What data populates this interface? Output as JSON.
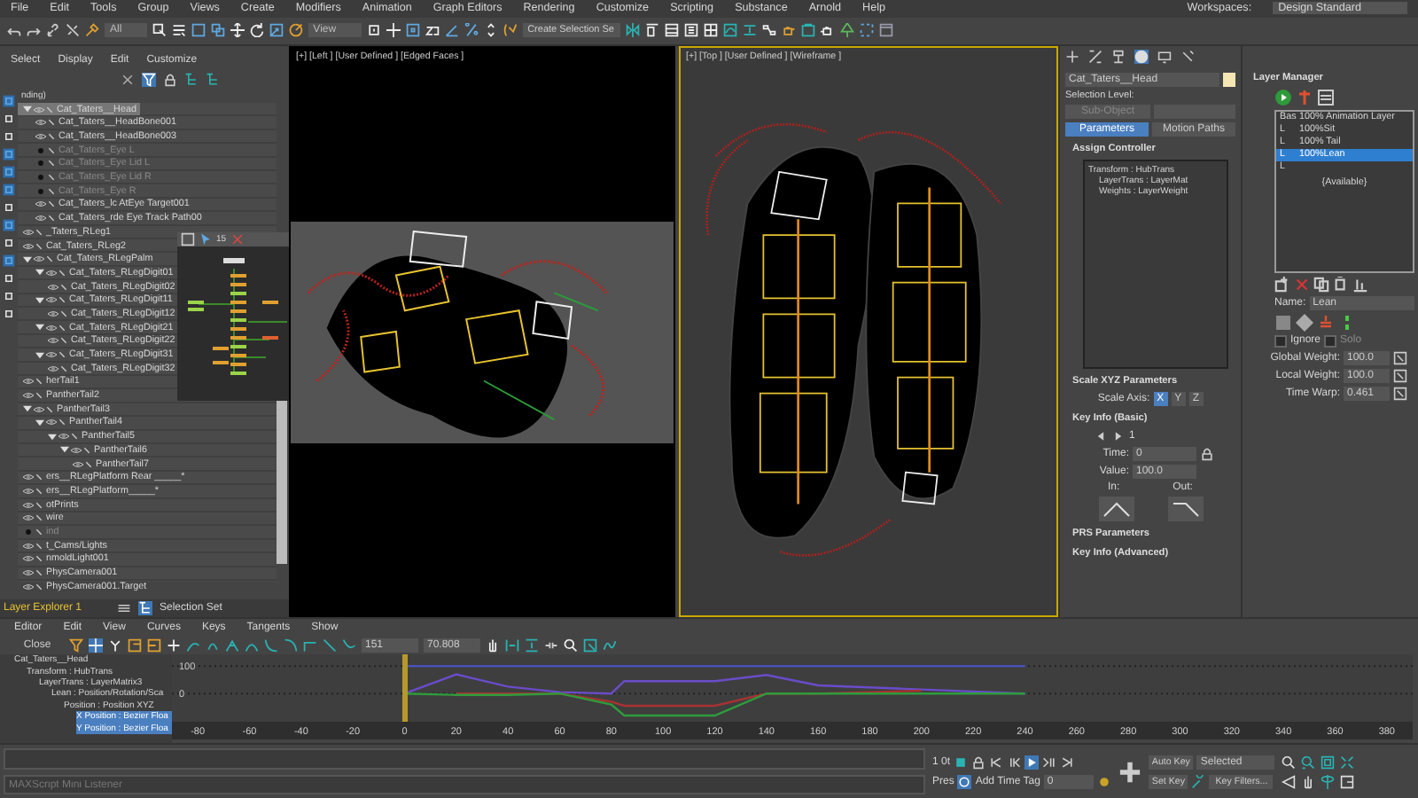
{
  "menu_bar": {
    "items": [
      "File",
      "Edit",
      "Tools",
      "Group",
      "Views",
      "Create",
      "Modifiers",
      "Animation",
      "Graph Editors",
      "Rendering",
      "Customize",
      "Scripting",
      "Substance",
      "Arnold",
      "Help"
    ],
    "workspaces_label": "Workspaces:",
    "workspace": "Design Standard"
  },
  "main_toolbar": {
    "selection_filter": "All",
    "reference_coord": "View",
    "selection_set_button": "Create Selection Se"
  },
  "scene_explorer": {
    "tabs": [
      "Select",
      "Display",
      "Edit",
      "Customize"
    ],
    "header": "nding)",
    "tree": [
      {
        "label": "Cat_Taters__Head",
        "selected": true,
        "visible": true,
        "children": [
          {
            "label": "Cat_Taters__HeadBone001",
            "selected": false,
            "visible": true
          },
          {
            "label": "Cat_Taters__HeadBone003",
            "selected": false,
            "visible": true
          },
          {
            "label": "Cat_Taters_Eye L",
            "selected": false,
            "visible": false
          },
          {
            "label": "Cat_Taters_Eye Lid L",
            "selected": false,
            "visible": false
          },
          {
            "label": "Cat_Taters_Eye Lid R",
            "selected": false,
            "visible": false
          },
          {
            "label": "Cat_Taters_Eye R",
            "selected": false,
            "visible": false
          },
          {
            "label": "Cat_Taters_lc AtEye Target001",
            "selected": false,
            "visible": true
          },
          {
            "label": "Cat_Taters_rde Eye Track Path00",
            "selected": false,
            "visible": true
          }
        ]
      },
      {
        "label": "_Taters_RLeg1",
        "selected": false,
        "visible": true
      },
      {
        "label": "Cat_Taters_RLeg2",
        "selected": false,
        "visible": true
      },
      {
        "label": "Cat_Taters_RLegPalm",
        "selected": false,
        "visible": true,
        "children": [
          {
            "label": "Cat_Taters_RLegDigit01",
            "selected": false,
            "visible": true,
            "children": [
              {
                "label": "Cat_Taters_RLegDigit02",
                "selected": false,
                "visible": true
              }
            ]
          },
          {
            "label": "Cat_Taters_RLegDigit11",
            "selected": false,
            "visible": true,
            "children": [
              {
                "label": "Cat_Taters_RLegDigit12",
                "selected": false,
                "visible": true
              }
            ]
          },
          {
            "label": "Cat_Taters_RLegDigit21",
            "selected": false,
            "visible": true,
            "children": [
              {
                "label": "Cat_Taters_RLegDigit22",
                "selected": false,
                "visible": true
              }
            ]
          },
          {
            "label": "Cat_Taters_RLegDigit31",
            "selected": false,
            "visible": true,
            "children": [
              {
                "label": "Cat_Taters_RLegDigit32",
                "selected": false,
                "visible": true
              }
            ]
          }
        ]
      },
      {
        "label": "herTail1",
        "selected": false,
        "visible": true
      },
      {
        "label": "PantherTail2",
        "selected": false,
        "visible": true
      },
      {
        "label": "PantherTail3",
        "selected": false,
        "visible": true,
        "children": [
          {
            "label": "PantherTail4",
            "selected": false,
            "visible": true,
            "children": [
              {
                "label": "PantherTail5",
                "selected": false,
                "visible": true,
                "children": [
                  {
                    "label": "PantherTail6",
                    "selected": false,
                    "visible": true,
                    "children": [
                      {
                        "label": "PantherTail7",
                        "selected": false,
                        "visible": true
                      }
                    ]
                  }
                ]
              }
            ]
          }
        ]
      },
      {
        "label": "ers__RLegPlatform Rear _____*",
        "selected": false,
        "visible": true
      },
      {
        "label": "ers__RLegPlatform_____*",
        "selected": false,
        "visible": true
      },
      {
        "label": "otPrints",
        "selected": false,
        "visible": true
      },
      {
        "label": "wire",
        "selected": false,
        "visible": true
      },
      {
        "label": "ind",
        "selected": false,
        "visible": false
      },
      {
        "label": "t_Cams/Lights",
        "selected": false,
        "visible": true
      },
      {
        "label": "nmoldLight001",
        "selected": false,
        "visible": true
      },
      {
        "label": "PhysCamera001",
        "selected": false,
        "visible": true
      },
      {
        "label": "PhysCamera001.Target",
        "selected": false,
        "visible": true
      }
    ],
    "explorer_name": "Layer Explorer 1",
    "selection_set": "Selection Set"
  },
  "schematic_view": {
    "count": "15"
  },
  "viewports": [
    {
      "label": "[+] [Left ] [User Defined ] [Edged Faces ]",
      "active": false
    },
    {
      "label": "[+] [Top ] [User Defined ] [Wireframe ]",
      "active": true
    }
  ],
  "command_panel": {
    "object_name": "Cat_Taters__Head",
    "swatch": {
      "color": "#f6e6b4"
    },
    "selection_level_label": "Selection Level:",
    "sub_object": "Sub-Object",
    "mode_buttons": [
      {
        "label": "Parameters",
        "selected": true
      },
      {
        "label": "Motion Paths",
        "selected": false
      }
    ],
    "assign_controller": {
      "title": "Assign Controller",
      "items": [
        "Transform : HubTrans",
        "LayerTrans : LayerMat",
        "Weights : LayerWeight"
      ]
    },
    "scale_xyz": {
      "title": "Scale XYZ Parameters",
      "axis_label": "Scale Axis:",
      "axes": [
        {
          "label": "X",
          "selected": true
        },
        {
          "label": "Y",
          "selected": false
        },
        {
          "label": "Z",
          "selected": false
        }
      ]
    },
    "key_info": {
      "title": "Key Info (Basic)",
      "key_number": "1",
      "time_label": "Time:",
      "time": "0",
      "value_label": "Value:",
      "value": "100.0",
      "in_label": "In:",
      "out_label": "Out:"
    },
    "collapsed_rollouts": [
      "PRS Parameters",
      "Key Info (Advanced)"
    ]
  },
  "layer_manager": {
    "title": "Layer Manager",
    "layers": [
      {
        "tag": "Bas",
        "label": "100% Animation Layer",
        "selected": false
      },
      {
        "tag": "L",
        "label": "100%Sit",
        "selected": false
      },
      {
        "tag": "L",
        "label": "100% Tail",
        "selected": false
      },
      {
        "tag": "L",
        "label": "100%Lean",
        "selected": true
      },
      {
        "tag": "L",
        "selected": false
      }
    ],
    "available": "{Available}",
    "name_label": "Name:",
    "name": "Lean",
    "ignore": {
      "label": "Ignore",
      "checked": false
    },
    "solo": {
      "label": "Solo",
      "checked": false
    },
    "weights": [
      {
        "label": "Global Weight:",
        "value": "100.0"
      },
      {
        "label": "Local Weight:",
        "value": "100.0"
      },
      {
        "label": "Time Warp:",
        "value": "0.461"
      }
    ]
  },
  "curve_editor": {
    "menu": [
      "Editor",
      "Edit",
      "View",
      "Curves",
      "Keys",
      "Tangents",
      "Show"
    ],
    "close_button": "Close",
    "frame_field": "151",
    "value_field": "70.808",
    "tree": [
      {
        "label": "Cat_Taters__Head",
        "selected": false,
        "children": [
          {
            "label": "Transform : HubTrans",
            "selected": false,
            "children": [
              {
                "label": "LayerTrans : LayerMatrix3",
                "selected": false,
                "children": [
                  {
                    "label": "Lean : Position/Rotation/Sca",
                    "selected": false,
                    "children": [
                      {
                        "label": "Position : Position XYZ",
                        "selected": false,
                        "children": [
                          {
                            "label": "X Position : Bezier Floa",
                            "selected": true
                          },
                          {
                            "label": "Y Position : Bezier Floa",
                            "selected": true
                          }
                        ]
                      }
                    ]
                  }
                ]
              }
            ]
          }
        ]
      }
    ],
    "chart_data": {
      "type": "line",
      "x": [
        0,
        20,
        40,
        60,
        80,
        85,
        100,
        120,
        140,
        160,
        200,
        240
      ],
      "series": [
        {
          "color": "#4a52b8",
          "values": [
            100,
            100,
            100,
            100,
            100,
            100,
            100,
            100,
            100,
            100,
            100,
            100
          ]
        },
        {
          "color": "#6a4cc8",
          "values": [
            0,
            70,
            25,
            5,
            0,
            45,
            45,
            45,
            68,
            30,
            15,
            0
          ]
        },
        {
          "color": "#a83232",
          "values": [
            null,
            0,
            0,
            0,
            -30,
            -45,
            -45,
            -45,
            0,
            0,
            10,
            null
          ]
        },
        {
          "color": "#2f9c3c",
          "values": [
            0,
            -5,
            -5,
            0,
            -40,
            -80,
            -80,
            -80,
            0,
            0,
            0,
            0
          ]
        }
      ],
      "xlim": [
        -90,
        390
      ],
      "ylim": [
        -90,
        130
      ],
      "xticks": [
        -80,
        -60,
        -40,
        -20,
        0,
        20,
        40,
        60,
        80,
        100,
        120,
        140,
        160,
        180,
        200,
        220,
        240,
        260,
        280,
        300,
        320,
        340,
        360,
        380
      ],
      "yticks": [
        0,
        100
      ]
    }
  },
  "status_bar": {
    "listener_placeholder": "MAXScript Mini Listener",
    "time_config": "1 0t",
    "pres": "Pres",
    "add_time_tag": "Add Time Tag",
    "frame": "0",
    "auto_key": "Auto Key",
    "set_key": "Set Key",
    "key_mode": "Selected",
    "key_filters": "Key Filters..."
  }
}
